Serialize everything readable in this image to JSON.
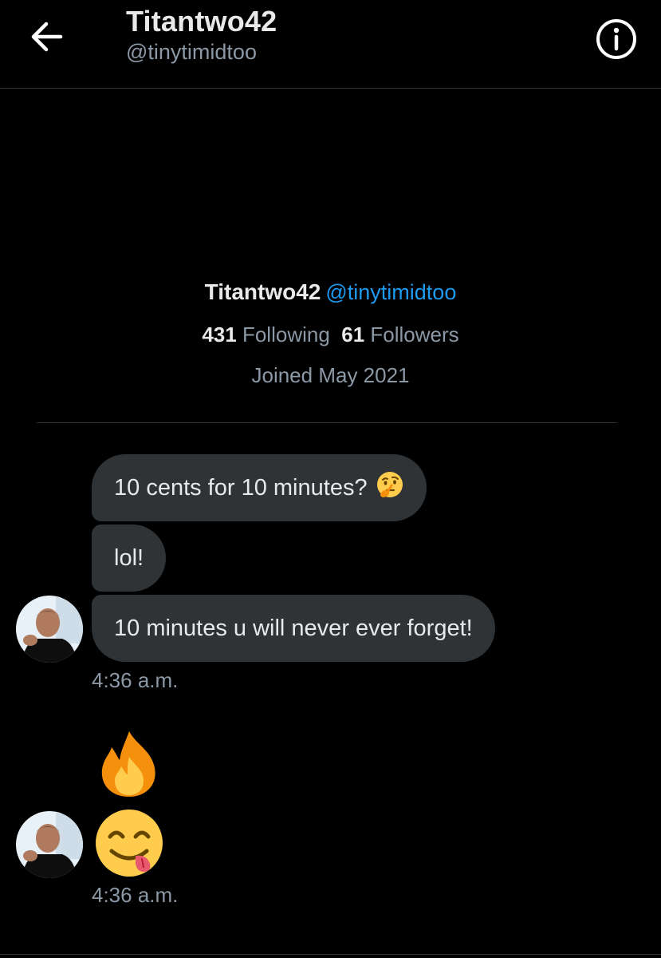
{
  "header": {
    "title": "Titantwo42",
    "handle": "@tinytimidtoo",
    "back_icon": "arrow-left-icon",
    "info_icon": "info-icon"
  },
  "profile": {
    "name": "Titantwo42",
    "handle": "@tinytimidtoo",
    "following_count": "431",
    "following_label": "Following",
    "followers_count": "61",
    "followers_label": "Followers",
    "joined": "Joined May 2021"
  },
  "messages": [
    {
      "text": "10 cents for 10 minutes?",
      "emoji": "thinking-face-icon"
    },
    {
      "text": "lol!"
    },
    {
      "text": "10 minutes u will never ever forget!"
    }
  ],
  "timestamp_1": "4:36 a.m.",
  "emoji_messages": [
    "fire-icon",
    "face-savoring-food-icon"
  ],
  "timestamp_2": "4:36 a.m.",
  "colors": {
    "background": "#000000",
    "bubble": "#2f3336",
    "accent": "#1d9bf0",
    "muted": "#8b98a5"
  }
}
